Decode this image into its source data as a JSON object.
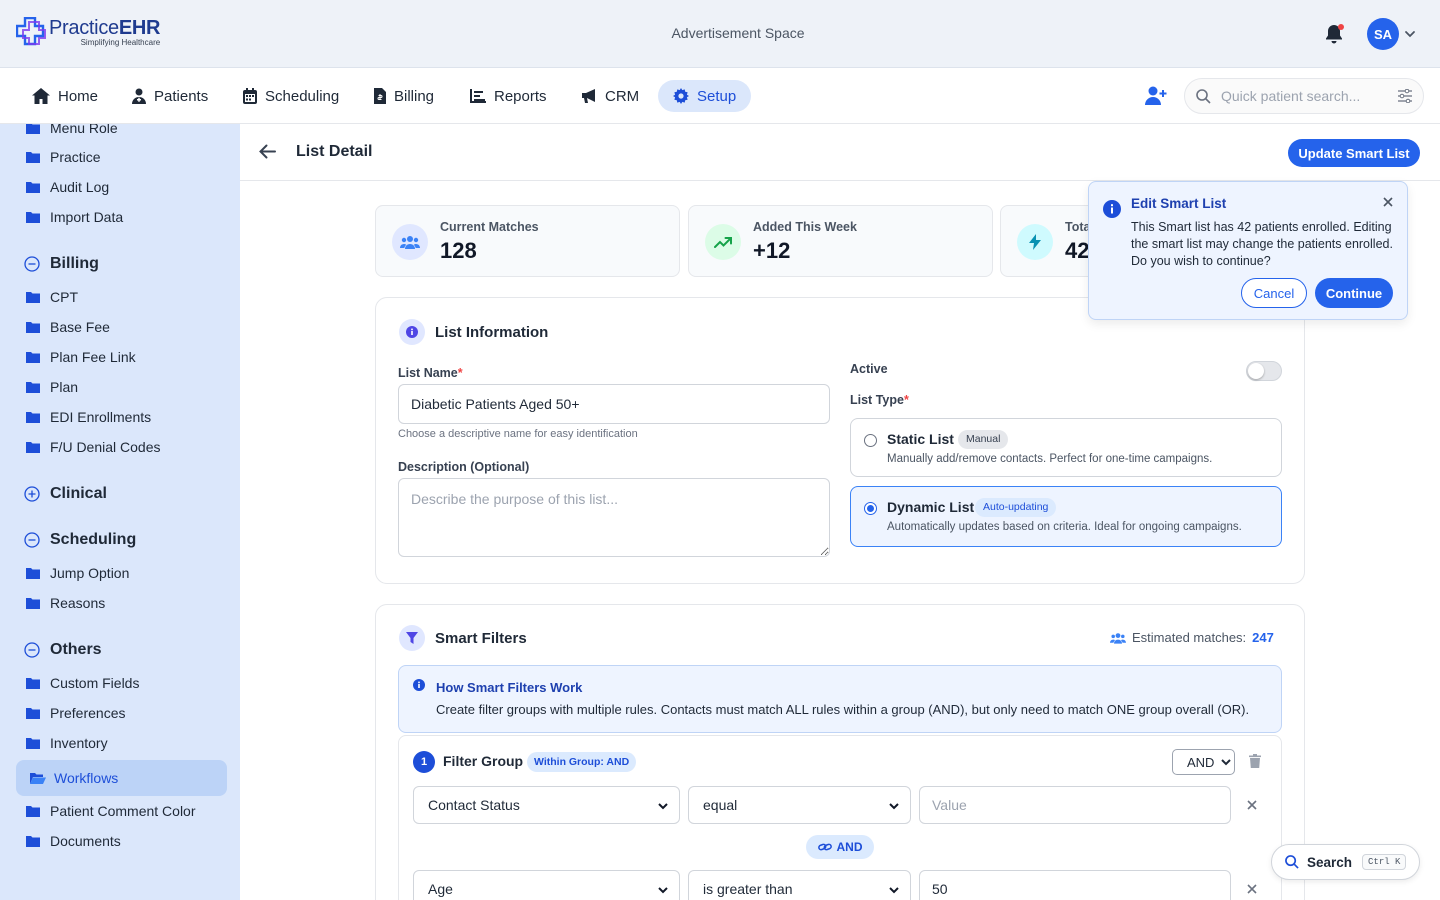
{
  "brand": {
    "name_regular": "Practice",
    "name_bold": "EHR",
    "tagline": "Simplifying Healthcare"
  },
  "header": {
    "ad_text": "Advertisement Space",
    "avatar_initials": "SA"
  },
  "nav": {
    "items": [
      {
        "label": "Home",
        "icon": "home-icon"
      },
      {
        "label": "Patients",
        "icon": "patient-icon"
      },
      {
        "label": "Scheduling",
        "icon": "calendar-icon"
      },
      {
        "label": "Billing",
        "icon": "invoice-icon"
      },
      {
        "label": "Reports",
        "icon": "chart-icon"
      },
      {
        "label": "CRM",
        "icon": "megaphone-icon"
      },
      {
        "label": "Setup",
        "icon": "gear-icon",
        "active": true
      }
    ],
    "search_placeholder": "Quick patient search..."
  },
  "sidebar": {
    "top_items": [
      "Menu Role",
      "Practice",
      "Audit Log",
      "Import Data"
    ],
    "billing": {
      "title": "Billing",
      "items": [
        "CPT",
        "Base Fee",
        "Plan Fee Link",
        "Plan",
        "EDI Enrollments",
        "F/U Denial Codes"
      ]
    },
    "clinical": {
      "title": "Clinical"
    },
    "scheduling": {
      "title": "Scheduling",
      "items": [
        "Jump Option",
        "Reasons"
      ]
    },
    "others": {
      "title": "Others",
      "items": [
        "Custom Fields",
        "Preferences",
        "Inventory"
      ],
      "active_item": "Workflows",
      "items_after": [
        "Patient Comment Color",
        "Documents"
      ]
    }
  },
  "page": {
    "title": "List Detail",
    "update_button": "Update Smart List"
  },
  "stats": [
    {
      "label": "Current Matches",
      "value": "128"
    },
    {
      "label": "Added This Week",
      "value": "+12"
    },
    {
      "label": "Tota",
      "value": "42"
    }
  ],
  "list_info": {
    "title": "List Information",
    "name_label": "List Name",
    "required_mark": "*",
    "name_value": "Diabetic Patients Aged 50+",
    "name_hint": "Choose a descriptive name for easy identification",
    "desc_label": "Description (Optional)",
    "desc_placeholder": "Describe the purpose of this list...",
    "active_label": "Active",
    "type_label": "List Type",
    "types": [
      {
        "name": "Static List",
        "badge": "Manual",
        "desc": "Manually add/remove contacts. Perfect for one-time campaigns.",
        "selected": false
      },
      {
        "name": "Dynamic List",
        "badge": "Auto-updating",
        "desc": "Automatically updates based on criteria. Ideal for ongoing campaigns.",
        "selected": true
      }
    ]
  },
  "smart_filters": {
    "title": "Smart Filters",
    "estimated_label": "Estimated matches:",
    "estimated_value": "247",
    "info_title": "How Smart Filters Work",
    "info_text": "Create filter groups with multiple rules. Contacts must match ALL rules within a group (AND), but only need to match ONE group overall (OR).",
    "group": {
      "number": "1",
      "title": "Filter Group",
      "badge": "Within Group: AND",
      "logic": "AND",
      "connector": "AND",
      "rules": [
        {
          "field": "Contact Status",
          "operator": "equal",
          "value": "",
          "value_placeholder": "Value"
        },
        {
          "field": "Age",
          "operator": "is greater than",
          "value": "50",
          "value_placeholder": ""
        }
      ]
    }
  },
  "popover": {
    "title": "Edit Smart List",
    "message": "This Smart list has 42 patients enrolled. Editing the smart list may change the patients enrolled. Do you wish to continue?",
    "cancel": "Cancel",
    "continue": "Continue"
  },
  "floating_search": {
    "label": "Search",
    "shortcut": "Ctrl K"
  },
  "colors": {
    "primary": "#2563eb",
    "sidebar_bg": "#dbe7fb",
    "header_bg": "#eef2f8"
  }
}
